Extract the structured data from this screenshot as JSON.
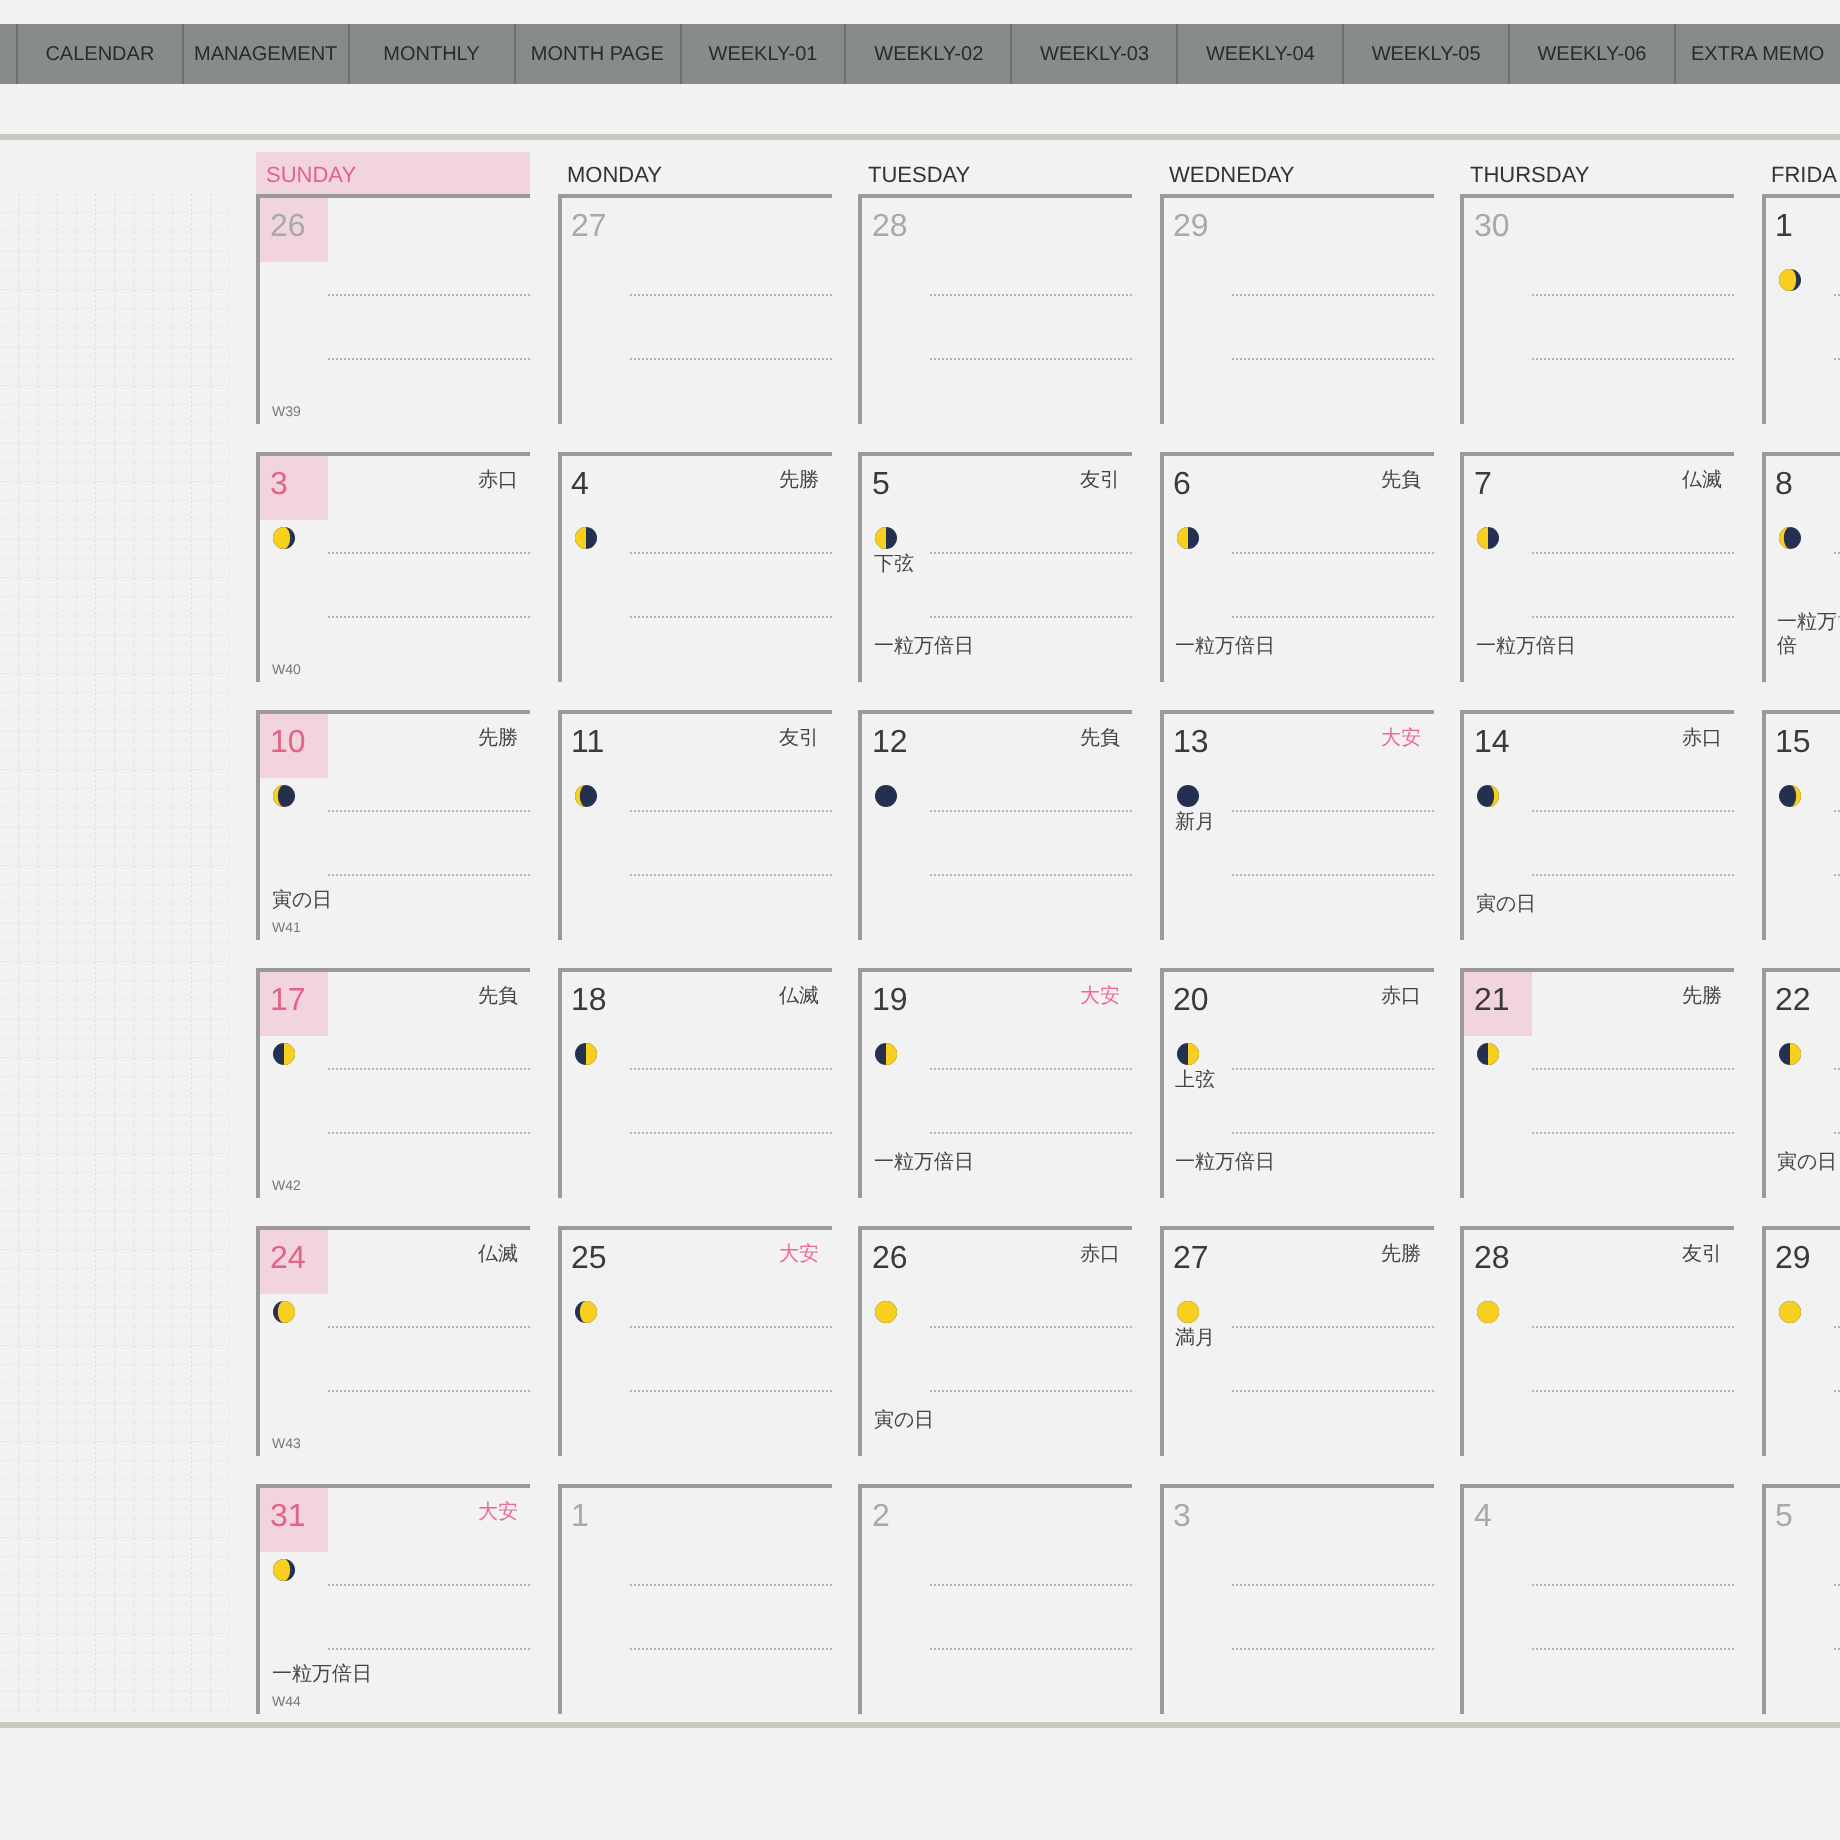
{
  "nav_tabs": [
    {
      "label": "CALENDAR"
    },
    {
      "label": "MANAGEMENT"
    },
    {
      "label": "MONTHLY"
    },
    {
      "label": "MONTH PAGE"
    },
    {
      "label": "WEEKLY-01"
    },
    {
      "label": "WEEKLY-02"
    },
    {
      "label": "WEEKLY-03"
    },
    {
      "label": "WEEKLY-04"
    },
    {
      "label": "WEEKLY-05"
    },
    {
      "label": "WEEKLY-06"
    },
    {
      "label": "EXTRA MEMO"
    }
  ],
  "weekdays": [
    {
      "label": "SUNDAY",
      "highlight": true
    },
    {
      "label": "MONDAY",
      "highlight": false
    },
    {
      "label": "TUESDAY",
      "highlight": false
    },
    {
      "label": "WEDNEDAY",
      "highlight": false
    },
    {
      "label": "THURSDAY",
      "highlight": false
    },
    {
      "label": "FRIDA",
      "highlight": false
    }
  ],
  "weeks": [
    {
      "week": "W39",
      "days": [
        {
          "day": "26",
          "muted": true,
          "highlight": true
        },
        {
          "day": "27",
          "muted": true,
          "highlight": false
        },
        {
          "day": "28",
          "muted": true,
          "highlight": false
        },
        {
          "day": "29",
          "muted": true,
          "highlight": false
        },
        {
          "day": "30",
          "muted": true,
          "highlight": false
        },
        {
          "day": "1",
          "muted": false,
          "sunday": false,
          "highlight": false,
          "moon": {
            "kind": "waning_gibbous"
          }
        }
      ]
    },
    {
      "week": "W40",
      "days": [
        {
          "day": "3",
          "muted": false,
          "sunday": true,
          "highlight": true,
          "rokuyo": "赤口",
          "rokuyo_lucky": false,
          "moon": {
            "kind": "waning_gibbous"
          }
        },
        {
          "day": "4",
          "muted": false,
          "sunday": false,
          "highlight": false,
          "rokuyo": "先勝",
          "rokuyo_lucky": false,
          "moon": {
            "kind": "last_quarter"
          }
        },
        {
          "day": "5",
          "muted": false,
          "sunday": false,
          "highlight": false,
          "rokuyo": "友引",
          "rokuyo_lucky": false,
          "moon": {
            "kind": "last_quarter"
          },
          "moon_label": "下弦",
          "note": "一粒万倍日"
        },
        {
          "day": "6",
          "muted": false,
          "sunday": false,
          "highlight": false,
          "rokuyo": "先負",
          "rokuyo_lucky": false,
          "moon": {
            "kind": "last_quarter"
          },
          "note": "一粒万倍日"
        },
        {
          "day": "7",
          "muted": false,
          "sunday": false,
          "highlight": false,
          "rokuyo": "仏滅",
          "rokuyo_lucky": false,
          "moon": {
            "kind": "last_quarter"
          },
          "note": "一粒万倍日"
        },
        {
          "day": "8",
          "muted": false,
          "sunday": false,
          "highlight": false,
          "moon": {
            "kind": "waning_crescent"
          },
          "note": "一粒万倍"
        }
      ]
    },
    {
      "week": "W41",
      "days": [
        {
          "day": "10",
          "muted": false,
          "sunday": true,
          "highlight": true,
          "rokuyo": "先勝",
          "rokuyo_lucky": false,
          "moon": {
            "kind": "waning_crescent"
          },
          "note": "寅の日"
        },
        {
          "day": "11",
          "muted": false,
          "sunday": false,
          "highlight": false,
          "rokuyo": "友引",
          "rokuyo_lucky": false,
          "moon": {
            "kind": "waning_crescent"
          }
        },
        {
          "day": "12",
          "muted": false,
          "sunday": false,
          "highlight": false,
          "rokuyo": "先負",
          "rokuyo_lucky": false,
          "moon": {
            "kind": "new"
          }
        },
        {
          "day": "13",
          "muted": false,
          "sunday": false,
          "highlight": false,
          "rokuyo": "大安",
          "rokuyo_lucky": true,
          "moon": {
            "kind": "new"
          },
          "moon_label": "新月"
        },
        {
          "day": "14",
          "muted": false,
          "sunday": false,
          "highlight": false,
          "rokuyo": "赤口",
          "rokuyo_lucky": false,
          "moon": {
            "kind": "waxing_crescent"
          },
          "note": "寅の日"
        },
        {
          "day": "15",
          "muted": false,
          "sunday": false,
          "highlight": false,
          "moon": {
            "kind": "waxing_crescent"
          }
        }
      ]
    },
    {
      "week": "W42",
      "days": [
        {
          "day": "17",
          "muted": false,
          "sunday": true,
          "highlight": true,
          "rokuyo": "先負",
          "rokuyo_lucky": false,
          "moon": {
            "kind": "first_quarter"
          }
        },
        {
          "day": "18",
          "muted": false,
          "sunday": false,
          "highlight": false,
          "rokuyo": "仏滅",
          "rokuyo_lucky": false,
          "moon": {
            "kind": "first_quarter"
          }
        },
        {
          "day": "19",
          "muted": false,
          "sunday": false,
          "highlight": false,
          "rokuyo": "大安",
          "rokuyo_lucky": true,
          "moon": {
            "kind": "first_quarter"
          },
          "note": "一粒万倍日"
        },
        {
          "day": "20",
          "muted": false,
          "sunday": false,
          "highlight": false,
          "rokuyo": "赤口",
          "rokuyo_lucky": false,
          "moon": {
            "kind": "first_quarter"
          },
          "moon_label": "上弦",
          "note": "一粒万倍日"
        },
        {
          "day": "21",
          "muted": false,
          "sunday": false,
          "highlight": true,
          "rokuyo": "先勝",
          "rokuyo_lucky": false,
          "moon": {
            "kind": "first_quarter"
          }
        },
        {
          "day": "22",
          "muted": false,
          "sunday": false,
          "highlight": false,
          "moon": {
            "kind": "first_quarter"
          },
          "note": "寅の日"
        }
      ]
    },
    {
      "week": "W43",
      "days": [
        {
          "day": "24",
          "muted": false,
          "sunday": true,
          "highlight": true,
          "rokuyo": "仏滅",
          "rokuyo_lucky": false,
          "moon": {
            "kind": "waxing_gibbous"
          }
        },
        {
          "day": "25",
          "muted": false,
          "sunday": false,
          "highlight": false,
          "rokuyo": "大安",
          "rokuyo_lucky": true,
          "moon": {
            "kind": "waxing_gibbous"
          }
        },
        {
          "day": "26",
          "muted": false,
          "sunday": false,
          "highlight": false,
          "rokuyo": "赤口",
          "rokuyo_lucky": false,
          "moon": {
            "kind": "full"
          },
          "note": "寅の日"
        },
        {
          "day": "27",
          "muted": false,
          "sunday": false,
          "highlight": false,
          "rokuyo": "先勝",
          "rokuyo_lucky": false,
          "moon": {
            "kind": "full"
          },
          "moon_label": "満月"
        },
        {
          "day": "28",
          "muted": false,
          "sunday": false,
          "highlight": false,
          "rokuyo": "友引",
          "rokuyo_lucky": false,
          "moon": {
            "kind": "full"
          }
        },
        {
          "day": "29",
          "muted": false,
          "sunday": false,
          "highlight": false,
          "moon": {
            "kind": "full"
          }
        }
      ]
    },
    {
      "week": "W44",
      "days": [
        {
          "day": "31",
          "muted": false,
          "sunday": true,
          "highlight": true,
          "rokuyo": "大安",
          "rokuyo_lucky": true,
          "moon": {
            "kind": "waning_gibbous"
          },
          "note": "一粒万倍日"
        },
        {
          "day": "1",
          "muted": true,
          "highlight": false
        },
        {
          "day": "2",
          "muted": true,
          "highlight": false
        },
        {
          "day": "3",
          "muted": true,
          "highlight": false
        },
        {
          "day": "4",
          "muted": true,
          "highlight": false
        },
        {
          "day": "5",
          "muted": true,
          "highlight": false
        }
      ]
    }
  ]
}
